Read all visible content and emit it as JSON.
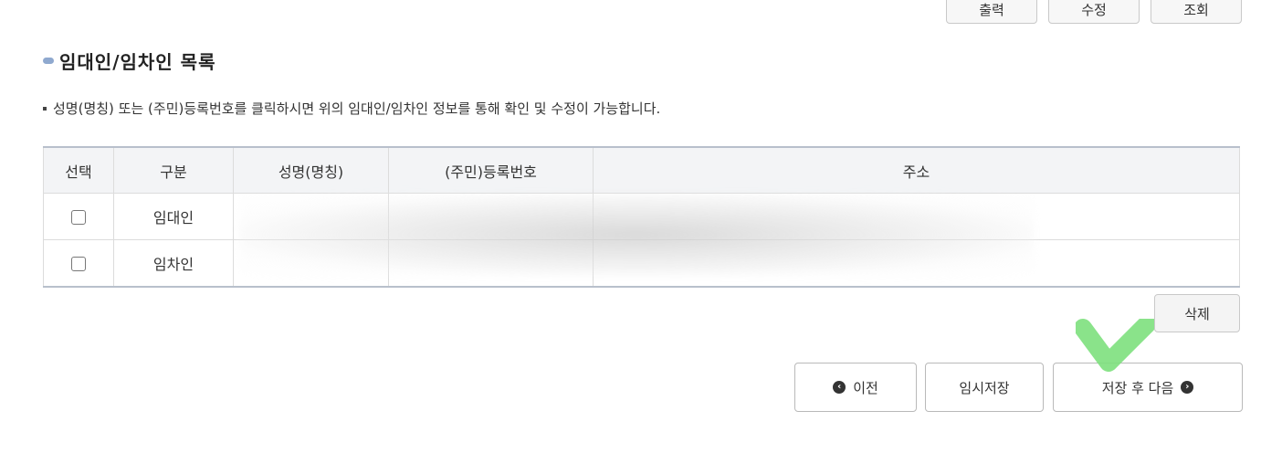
{
  "top_buttons": [
    "출력",
    "수정",
    "조회"
  ],
  "section": {
    "title": "임대인/임차인 목록",
    "notice": "성명(명칭) 또는 (주민)등록번호를 클릭하시면 위의 임대인/임차인 정보를 통해 확인 및 수정이 가능합니다."
  },
  "table": {
    "headers": [
      "선택",
      "구분",
      "성명(명칭)",
      "(주민)등록번호",
      "주소"
    ],
    "rows": [
      {
        "type": "임대인",
        "name": "",
        "reg_no": "",
        "address": ""
      },
      {
        "type": "임차인",
        "name": "",
        "reg_no": "",
        "address": ""
      }
    ]
  },
  "buttons": {
    "delete": "삭제",
    "prev": "이전",
    "temp_save": "임시저장",
    "save_next": "저장 후 다음"
  },
  "colors": {
    "title_marker": "#8fa9cf",
    "table_header_bg": "#f3f4f6",
    "table_border": "#b8c0cc",
    "check_overlay": "#7de07d"
  },
  "icons": {
    "prev": "circle-chevron-left-icon",
    "next": "circle-chevron-right-icon"
  }
}
